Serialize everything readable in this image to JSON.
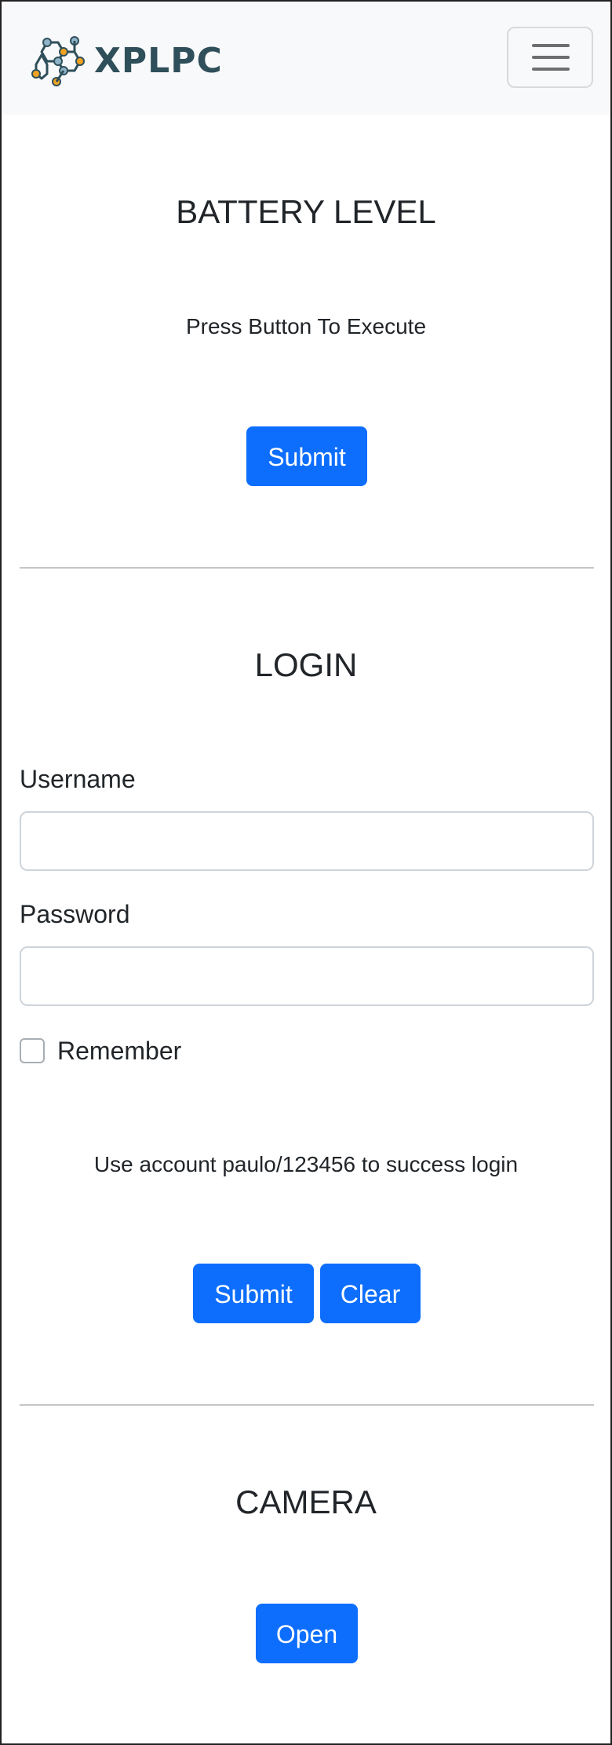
{
  "navbar": {
    "brand_text": "XPLPC",
    "logo_icon": "molecule-hexagon-icon",
    "menu_icon": "hamburger-menu-icon"
  },
  "battery": {
    "title": "BATTERY LEVEL",
    "info": "Press Button To Execute",
    "submit_label": "Submit"
  },
  "login": {
    "title": "LOGIN",
    "username_label": "Username",
    "username_value": "",
    "username_placeholder": "",
    "password_label": "Password",
    "password_value": "",
    "password_placeholder": "",
    "remember_label": "Remember",
    "hint": "Use account paulo/123456 to success login",
    "submit_label": "Submit",
    "clear_label": "Clear"
  },
  "camera": {
    "title": "CAMERA",
    "open_label": "Open"
  },
  "colors": {
    "primary": "#0d6efd",
    "navbar_bg": "#f8f9fa",
    "brand_text": "#2f4f5a",
    "text": "#212529"
  }
}
